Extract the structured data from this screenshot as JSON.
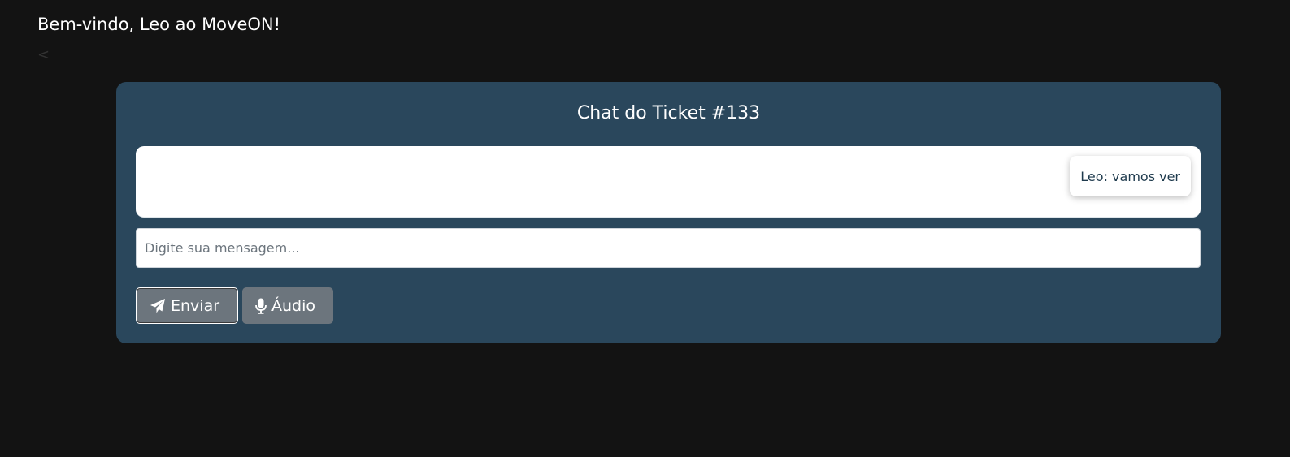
{
  "header": {
    "welcome_text": "Bem-vindo, Leo ao MoveON!",
    "back_label": "<"
  },
  "chat": {
    "title": "Chat do Ticket #133",
    "messages": [
      {
        "text": "Leo: vamos ver"
      }
    ],
    "input": {
      "placeholder": "Digite sua mensagem...",
      "value": ""
    },
    "buttons": {
      "send_label": "Enviar",
      "send_icon": "paper-plane-icon",
      "audio_label": "Áudio",
      "audio_icon": "microphone-icon"
    }
  },
  "colors": {
    "page_background": "#131313",
    "card_background": "#2a475c",
    "button_background": "#6c757d"
  }
}
